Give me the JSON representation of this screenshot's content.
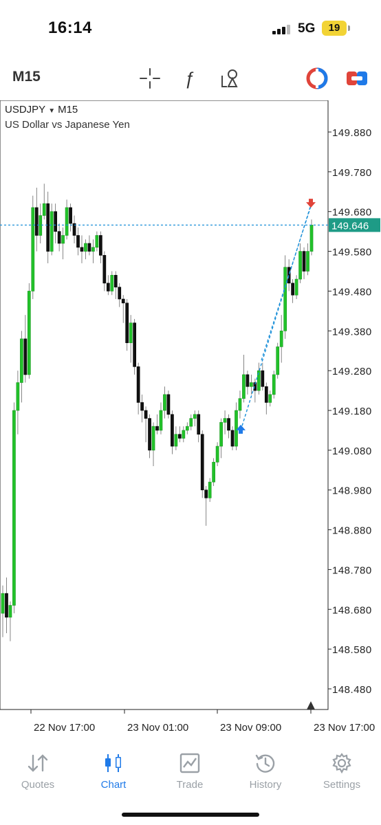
{
  "status_bar": {
    "time": "16:14",
    "network": "5G",
    "battery": "19"
  },
  "toolbar": {
    "timeframe": "M15",
    "tools": [
      "crosshair-icon",
      "function-icon",
      "objects-icon",
      "one-click-trading-icon",
      "trade-panel-icon"
    ]
  },
  "chart": {
    "symbol": "USDJPY",
    "timeframe": "M15",
    "description": "US Dollar vs Japanese Yen",
    "current_price": "149.646",
    "price_labels": [
      "149.880",
      "149.780",
      "149.680",
      "149.580",
      "149.480",
      "149.380",
      "149.280",
      "149.180",
      "149.080",
      "148.980",
      "148.880",
      "148.780",
      "148.680",
      "148.580",
      "148.480"
    ],
    "time_labels": [
      "22 Nov 17:00",
      "23 Nov 01:00",
      "23 Nov 09:00",
      "23 Nov 17:00"
    ],
    "colors": {
      "bull": "#22c22a",
      "bear": "#111111",
      "price_line": "#1a8fd8",
      "price_badge": "#1e9b86",
      "buy_arrow": "#1f7ae8",
      "sell_arrow": "#e0443a"
    }
  },
  "chart_data": {
    "type": "candlestick",
    "symbol": "USDJPY",
    "timeframe": "M15",
    "ylim": [
      148.42,
      149.94
    ],
    "y_ticks": [
      149.88,
      149.78,
      149.68,
      149.58,
      149.48,
      149.38,
      149.28,
      149.18,
      149.08,
      148.98,
      148.88,
      148.78,
      148.68,
      148.58,
      148.48
    ],
    "x_ticks": [
      "22 Nov 17:00",
      "23 Nov 01:00",
      "23 Nov 09:00",
      "23 Nov 17:00"
    ],
    "current_price": 149.646,
    "candles": [
      [
        148.67,
        148.74,
        148.61,
        148.72
      ],
      [
        148.72,
        148.76,
        148.62,
        148.66
      ],
      [
        148.66,
        148.7,
        148.6,
        148.69
      ],
      [
        148.69,
        149.2,
        148.67,
        149.18
      ],
      [
        149.18,
        149.28,
        149.12,
        149.25
      ],
      [
        149.25,
        149.38,
        149.2,
        149.36
      ],
      [
        149.36,
        149.42,
        149.25,
        149.27
      ],
      [
        149.27,
        149.5,
        149.26,
        149.48
      ],
      [
        149.48,
        149.72,
        149.46,
        149.69
      ],
      [
        149.69,
        149.74,
        149.58,
        149.62
      ],
      [
        149.62,
        149.7,
        149.6,
        149.67
      ],
      [
        149.67,
        149.75,
        149.66,
        149.7
      ],
      [
        149.7,
        149.73,
        149.55,
        149.58
      ],
      [
        149.58,
        149.7,
        149.57,
        149.68
      ],
      [
        149.68,
        149.7,
        149.6,
        149.63
      ],
      [
        149.63,
        149.65,
        149.58,
        149.6
      ],
      [
        149.6,
        149.64,
        149.56,
        149.62
      ],
      [
        149.62,
        149.71,
        149.61,
        149.69
      ],
      [
        149.69,
        149.7,
        149.63,
        149.65
      ],
      [
        149.65,
        149.67,
        149.6,
        149.62
      ],
      [
        149.62,
        149.64,
        149.57,
        149.59
      ],
      [
        149.59,
        149.62,
        149.55,
        149.58
      ],
      [
        149.58,
        149.61,
        149.56,
        149.6
      ],
      [
        149.6,
        149.62,
        149.57,
        149.58
      ],
      [
        149.58,
        149.61,
        149.55,
        149.59
      ],
      [
        149.59,
        149.63,
        149.58,
        149.62
      ],
      [
        149.62,
        149.63,
        149.55,
        149.57
      ],
      [
        149.57,
        149.58,
        149.48,
        149.5
      ],
      [
        149.5,
        149.52,
        149.47,
        149.48
      ],
      [
        149.48,
        149.53,
        149.47,
        149.52
      ],
      [
        149.52,
        149.53,
        149.46,
        149.49
      ],
      [
        149.49,
        149.5,
        149.44,
        149.46
      ],
      [
        149.46,
        149.47,
        149.4,
        149.45
      ],
      [
        149.45,
        149.46,
        149.33,
        149.35
      ],
      [
        149.35,
        149.42,
        149.3,
        149.4
      ],
      [
        149.4,
        149.41,
        149.27,
        149.29
      ],
      [
        149.29,
        149.3,
        149.17,
        149.2
      ],
      [
        149.2,
        149.22,
        149.15,
        149.18
      ],
      [
        149.18,
        149.19,
        149.1,
        149.16
      ],
      [
        149.16,
        149.17,
        149.06,
        149.08
      ],
      [
        149.08,
        149.15,
        149.04,
        149.14
      ],
      [
        149.14,
        149.17,
        149.12,
        149.13
      ],
      [
        149.13,
        149.2,
        149.12,
        149.18
      ],
      [
        149.18,
        149.24,
        149.16,
        149.22
      ],
      [
        149.22,
        149.23,
        149.16,
        149.17
      ],
      [
        149.17,
        149.18,
        149.07,
        149.09
      ],
      [
        149.09,
        149.14,
        149.08,
        149.12
      ],
      [
        149.12,
        149.14,
        149.1,
        149.11
      ],
      [
        149.11,
        149.14,
        149.1,
        149.13
      ],
      [
        149.13,
        149.15,
        149.12,
        149.14
      ],
      [
        149.14,
        149.17,
        149.13,
        149.16
      ],
      [
        149.16,
        149.18,
        149.14,
        149.17
      ],
      [
        149.17,
        149.18,
        149.1,
        149.12
      ],
      [
        149.12,
        149.13,
        148.96,
        148.98
      ],
      [
        148.98,
        148.99,
        148.89,
        148.96
      ],
      [
        148.96,
        149.01,
        148.95,
        149.0
      ],
      [
        149.0,
        149.06,
        148.99,
        149.05
      ],
      [
        149.05,
        149.1,
        149.04,
        149.09
      ],
      [
        149.09,
        149.16,
        149.06,
        149.15
      ],
      [
        149.15,
        149.18,
        149.12,
        149.16
      ],
      [
        149.16,
        149.17,
        149.11,
        149.13
      ],
      [
        149.13,
        149.14,
        149.08,
        149.09
      ],
      [
        149.09,
        149.2,
        149.08,
        149.18
      ],
      [
        149.18,
        149.23,
        149.16,
        149.21
      ],
      [
        149.21,
        149.32,
        149.2,
        149.27
      ],
      [
        149.27,
        149.28,
        149.22,
        149.24
      ],
      [
        149.24,
        149.27,
        149.22,
        149.25
      ],
      [
        149.25,
        149.26,
        149.2,
        149.23
      ],
      [
        149.23,
        149.3,
        149.22,
        149.28
      ],
      [
        149.28,
        149.3,
        149.23,
        149.24
      ],
      [
        149.24,
        149.25,
        149.17,
        149.2
      ],
      [
        149.2,
        149.23,
        149.19,
        149.22
      ],
      [
        149.22,
        149.28,
        149.21,
        149.27
      ],
      [
        149.27,
        149.35,
        149.26,
        149.34
      ],
      [
        149.34,
        149.42,
        149.3,
        149.38
      ],
      [
        149.38,
        149.57,
        149.36,
        149.54
      ],
      [
        149.54,
        149.56,
        149.48,
        149.5
      ],
      [
        149.5,
        149.51,
        149.45,
        149.47
      ],
      [
        149.47,
        149.52,
        149.46,
        149.51
      ],
      [
        149.51,
        149.6,
        149.5,
        149.58
      ],
      [
        149.58,
        149.59,
        149.51,
        149.53
      ],
      [
        149.53,
        149.6,
        149.52,
        149.58
      ],
      [
        149.58,
        149.66,
        149.57,
        149.646
      ]
    ],
    "trade_markers": [
      {
        "type": "buy",
        "price": 149.13
      },
      {
        "type": "sell",
        "price": 149.7
      }
    ]
  },
  "tabs": [
    {
      "label": "Quotes",
      "icon": "quotes-icon"
    },
    {
      "label": "Chart",
      "icon": "chart-icon",
      "active": true
    },
    {
      "label": "Trade",
      "icon": "trade-icon"
    },
    {
      "label": "History",
      "icon": "history-icon"
    },
    {
      "label": "Settings",
      "icon": "settings-icon"
    }
  ]
}
